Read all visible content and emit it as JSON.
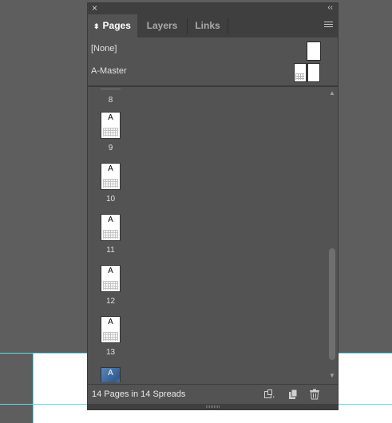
{
  "panel": {
    "close_glyph": "×",
    "collapse_glyph": "‹‹",
    "tabs": [
      {
        "label": "Pages",
        "active": true
      },
      {
        "label": "Layers",
        "active": false
      },
      {
        "label": "Links",
        "active": false
      }
    ],
    "sort_glyph": "⬍",
    "menu_icon": "hamburger-menu-icon"
  },
  "masters": [
    {
      "label": "[None]"
    },
    {
      "label": "A-Master"
    }
  ],
  "pages": {
    "partial_top_number": "8",
    "items": [
      {
        "master": "A",
        "number": "9"
      },
      {
        "master": "A",
        "number": "10"
      },
      {
        "master": "A",
        "number": "11"
      },
      {
        "master": "A",
        "number": "12"
      },
      {
        "master": "A",
        "number": "13"
      },
      {
        "master": "A",
        "number": ""
      }
    ]
  },
  "footer": {
    "status": "14 Pages in 14 Spreads",
    "buttons": [
      "edit-page-size-icon",
      "new-page-icon",
      "trash-icon"
    ]
  },
  "colors": {
    "canvas": "#5e5e5e",
    "panel": "#535353",
    "guide": "#5fd8e6",
    "page": "#ffffff"
  }
}
